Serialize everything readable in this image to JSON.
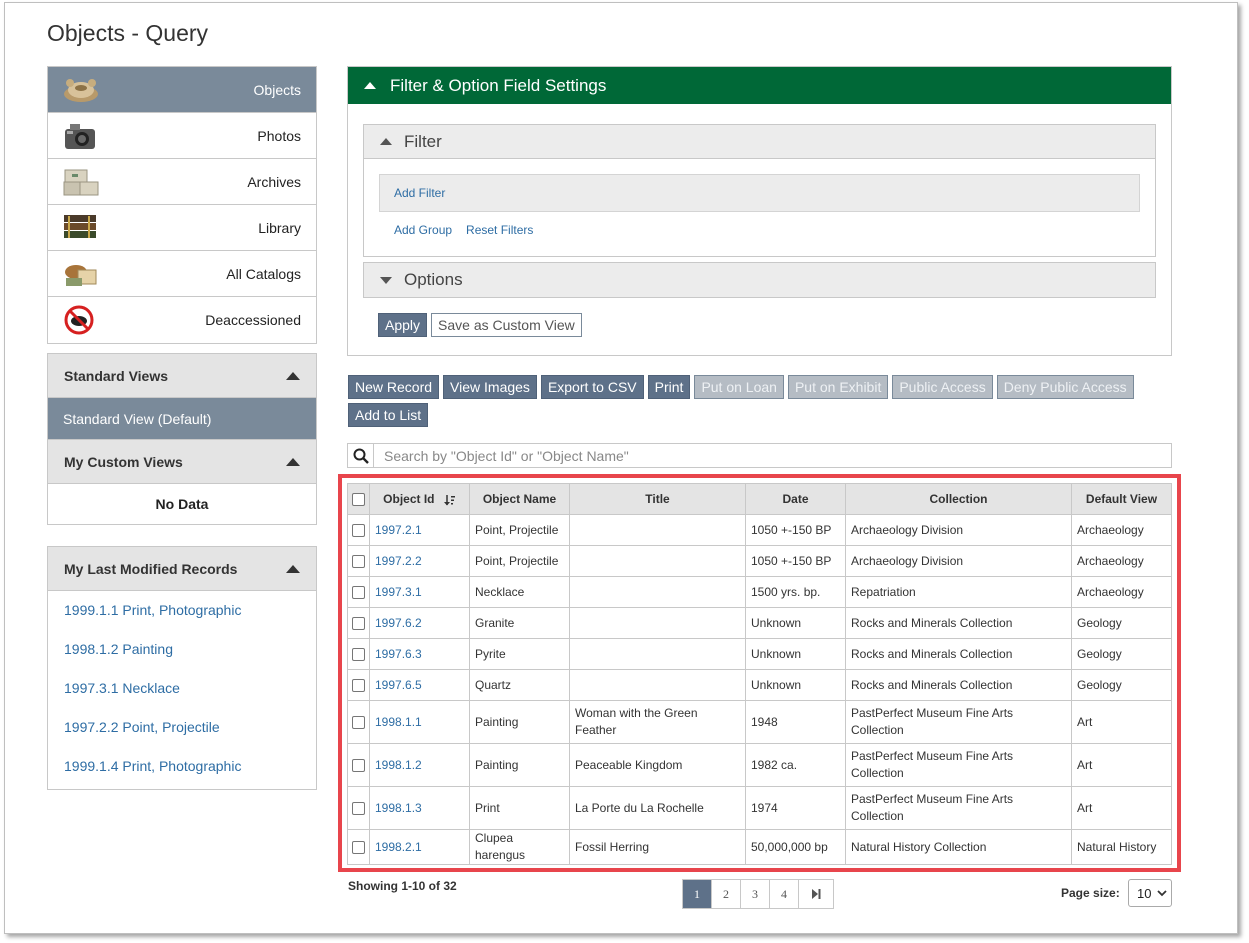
{
  "page": {
    "title": "Objects - Query"
  },
  "catalogs": [
    {
      "label": "Objects",
      "icon": "objects-icon",
      "active": true
    },
    {
      "label": "Photos",
      "icon": "camera-icon"
    },
    {
      "label": "Archives",
      "icon": "archive-boxes-icon"
    },
    {
      "label": "Library",
      "icon": "books-icon"
    },
    {
      "label": "All Catalogs",
      "icon": "all-catalogs-icon"
    },
    {
      "label": "Deaccessioned",
      "icon": "deaccessioned-icon"
    }
  ],
  "views": {
    "standard_title": "Standard Views",
    "standard_default": "Standard View (Default)",
    "custom_title": "My Custom Views",
    "custom_empty": "No Data"
  },
  "recent": {
    "title": "My Last Modified Records",
    "items": [
      "1999.1.1 Print, Photographic",
      "1998.1.2 Painting",
      "1997.3.1 Necklace",
      "1997.2.2 Point, Projectile",
      "1999.1.4 Print, Photographic"
    ]
  },
  "filter": {
    "header": "Filter & Option Field Settings",
    "filter_title": "Filter",
    "add_filter": "Add Filter",
    "add_group": "Add Group",
    "reset_filters": "Reset Filters",
    "options_title": "Options",
    "apply": "Apply",
    "save_custom": "Save as Custom View"
  },
  "toolbar": {
    "new_record": "New Record",
    "view_images": "View Images",
    "export_csv": "Export to CSV",
    "print": "Print",
    "put_on_loan": "Put on Loan",
    "put_on_exhibit": "Put on Exhibit",
    "public_access": "Public Access",
    "deny_public_access": "Deny Public Access",
    "add_to_list": "Add to List"
  },
  "search": {
    "placeholder": "Search by \"Object Id\" or \"Object Name\""
  },
  "table": {
    "columns": [
      "Object Id",
      "Object Name",
      "Title",
      "Date",
      "Collection",
      "Default View"
    ],
    "rows": [
      [
        "1997.2.1",
        "Point, Projectile",
        "",
        "1050 +-150 BP",
        "Archaeology Division",
        "Archaeology"
      ],
      [
        "1997.2.2",
        "Point, Projectile",
        "",
        "1050 +-150 BP",
        "Archaeology Division",
        "Archaeology"
      ],
      [
        "1997.3.1",
        "Necklace",
        "",
        "1500 yrs. bp.",
        "Repatriation",
        "Archaeology"
      ],
      [
        "1997.6.2",
        "Granite",
        "",
        "Unknown",
        "Rocks and Minerals Collection",
        "Geology"
      ],
      [
        "1997.6.3",
        "Pyrite",
        "",
        "Unknown",
        "Rocks and Minerals Collection",
        "Geology"
      ],
      [
        "1997.6.5",
        "Quartz",
        "",
        "Unknown",
        "Rocks and Minerals Collection",
        "Geology"
      ],
      [
        "1998.1.1",
        "Painting",
        "Woman with the Green Feather",
        "1948",
        "PastPerfect Museum Fine Arts Collection",
        "Art"
      ],
      [
        "1998.1.2",
        "Painting",
        "Peaceable Kingdom",
        "1982 ca.",
        "PastPerfect Museum Fine Arts Collection",
        "Art"
      ],
      [
        "1998.1.3",
        "Print",
        "La Porte du La Rochelle",
        "1974",
        "PastPerfect Museum Fine Arts Collection",
        "Art"
      ],
      [
        "1998.2.1",
        "Clupea harengus",
        "Fossil Herring",
        "50,000,000 bp",
        "Natural History Collection",
        "Natural History"
      ]
    ]
  },
  "pagination": {
    "showing": "Showing 1-10 of 32",
    "pages": [
      "1",
      "2",
      "3",
      "4"
    ],
    "current": "1",
    "page_size_label": "Page size:",
    "page_size": "10"
  },
  "colors": {
    "header_green": "#006837",
    "active_gray_blue": "#7a8a9a",
    "button_dark": "#5e7189",
    "highlight_red": "#e8454c",
    "link_blue": "#2e6da4"
  }
}
